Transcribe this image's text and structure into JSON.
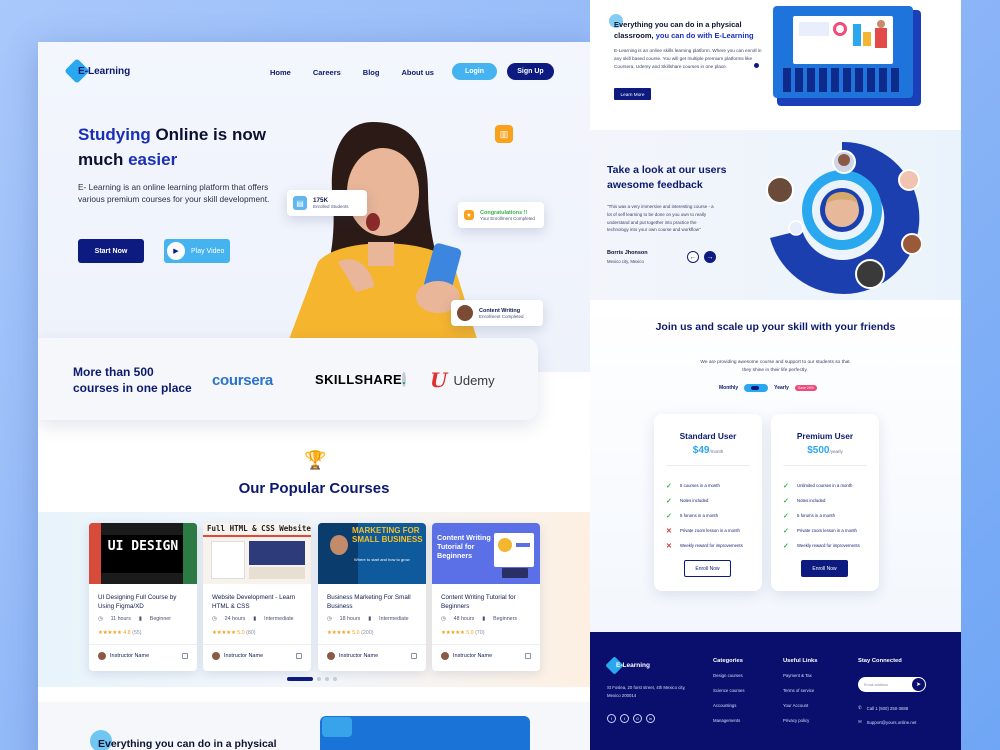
{
  "nav": {
    "logo": "E-Learning",
    "links": [
      "Home",
      "Careers",
      "Blog",
      "About us"
    ],
    "login": "Login",
    "signup": "Sign Up"
  },
  "hero": {
    "title_hl1": "Studying",
    "title_mid": " Online is now much ",
    "title_hl2": "easier",
    "description": "E- Learning is an online learning platform that offers various premium courses for your skill development.",
    "start_btn": "Start Now",
    "play_btn": "Play Video",
    "students_count": "175K",
    "students_label": "Enrolled Students",
    "congrats_title": "Congratulations !!",
    "congrats_sub": "Your Enrollment Completed",
    "writing_title": "Content Writing",
    "writing_sub": "Enrollment Completed"
  },
  "partners": {
    "lead": "More than 500 courses in one place",
    "coursera": "coursera",
    "skillshare": "SKILLSHARE",
    "skillshare_dot": ".",
    "udemy_mark": "U",
    "udemy": "Udemy"
  },
  "courses": {
    "section_title": "Our Popular Courses",
    "items": [
      {
        "title": "UI Designing Full Course by Using Figma/XD",
        "hours": "11 hours",
        "level": "Beginner",
        "stars": "★★★★★",
        "rating": "4.8",
        "count": "(55)",
        "instructor": "Instructor Name",
        "thumb_text": "UI DESIGN"
      },
      {
        "title": "Website Development - Learn HTML & CSS",
        "hours": "24 hours",
        "level": "Intermediate",
        "stars": "★★★★★",
        "rating": "5.0",
        "count": "(80)",
        "instructor": "Instructor Name",
        "thumb_text": "Full HTML & CSS Website"
      },
      {
        "title": "Business Marketing For Small Business",
        "hours": "18 hours",
        "level": "Intermediate",
        "stars": "★★★★★",
        "rating": "5.0",
        "count": "(200)",
        "instructor": "Instructor Name",
        "thumb_text": "MARKETING FOR SMALL BUSINESS",
        "thumb_sub": "Where to start and how to grow"
      },
      {
        "title": "Content Writing Tutorial for Beginners",
        "hours": "48 hours",
        "level": "Beginners",
        "stars": "★★★★★",
        "rating": "5.0",
        "count": "(70)",
        "instructor": "Instructor Name",
        "thumb_text": "Content Writing Tutorial for Beginners"
      }
    ]
  },
  "bottom_peek": {
    "text": "Everything you can do in a physical"
  },
  "classroom": {
    "heading_a": "Everything you can do in a physical classroom, ",
    "heading_hl": "you can do with E-Learning",
    "description": "E-Learning is an online skills learning platform. Where you can enroll in any skill based course. You will get multiple premium platforms like Coursera, Udemy and Skillshare courses in one place.",
    "learn_more": "Learn More"
  },
  "feedback": {
    "title": "Take a look at our users awesome feedback",
    "quote": "\"This was a very immersive and interesting course - a lot of self learning to be done on you own to really understand and put together into practice the technology into your own course and workflow\"",
    "name": "Borris Jhonson",
    "location": "Mexico city, Mexico"
  },
  "pricing": {
    "title": "Join us and scale up your skill with your friends",
    "subtitle": "We are providing awesome course and support to our students so that they shine in their life perfectly.",
    "monthly": "Monthly",
    "yearly": "Yearly",
    "badge": "Save 20%",
    "plans": [
      {
        "name": "Standard User",
        "price": "$49",
        "period": "/month",
        "cta": "Enroll Now",
        "features": [
          {
            "text": "5 courses in a month",
            "ok": true
          },
          {
            "text": "Notes included",
            "ok": true
          },
          {
            "text": "5 forums in a month",
            "ok": true
          },
          {
            "text": "Private zoom lesson in a month",
            "ok": false
          },
          {
            "text": "Weekly reward for improvements",
            "ok": false
          }
        ]
      },
      {
        "name": "Premium User",
        "price": "$500",
        "period": "/yearly",
        "cta": "Enroll Now",
        "features": [
          {
            "text": "Unlimited courses in a month",
            "ok": true
          },
          {
            "text": "Notes included",
            "ok": true
          },
          {
            "text": "5 forums in a month",
            "ok": true
          },
          {
            "text": "Private zoom lesson in a month",
            "ok": true
          },
          {
            "text": "Weekly reward for improvements",
            "ok": true
          }
        ]
      }
    ]
  },
  "footer": {
    "logo": "E-Learning",
    "address": "St Foslea, 20 forst street, 4th Mexico city, Mexico 200014",
    "socials": [
      "f",
      "t",
      "G",
      "in"
    ],
    "categories_title": "Categories",
    "categories": [
      "Design courses",
      "Science courses",
      "Accountings",
      "Managements"
    ],
    "links_title": "Useful Links",
    "links": [
      "Payment & Tax",
      "Terms of service",
      "Your Account",
      "Privacy policy"
    ],
    "connect_title": "Stay Connected",
    "email_placeholder": "Email address",
    "phone": "Call 1 (500) 250-3688",
    "email": "Support@yours.online.net"
  },
  "colors": {
    "navy": "#0d1a80",
    "accent_blue": "#2aa8ef",
    "background": "#8fb7f7"
  }
}
